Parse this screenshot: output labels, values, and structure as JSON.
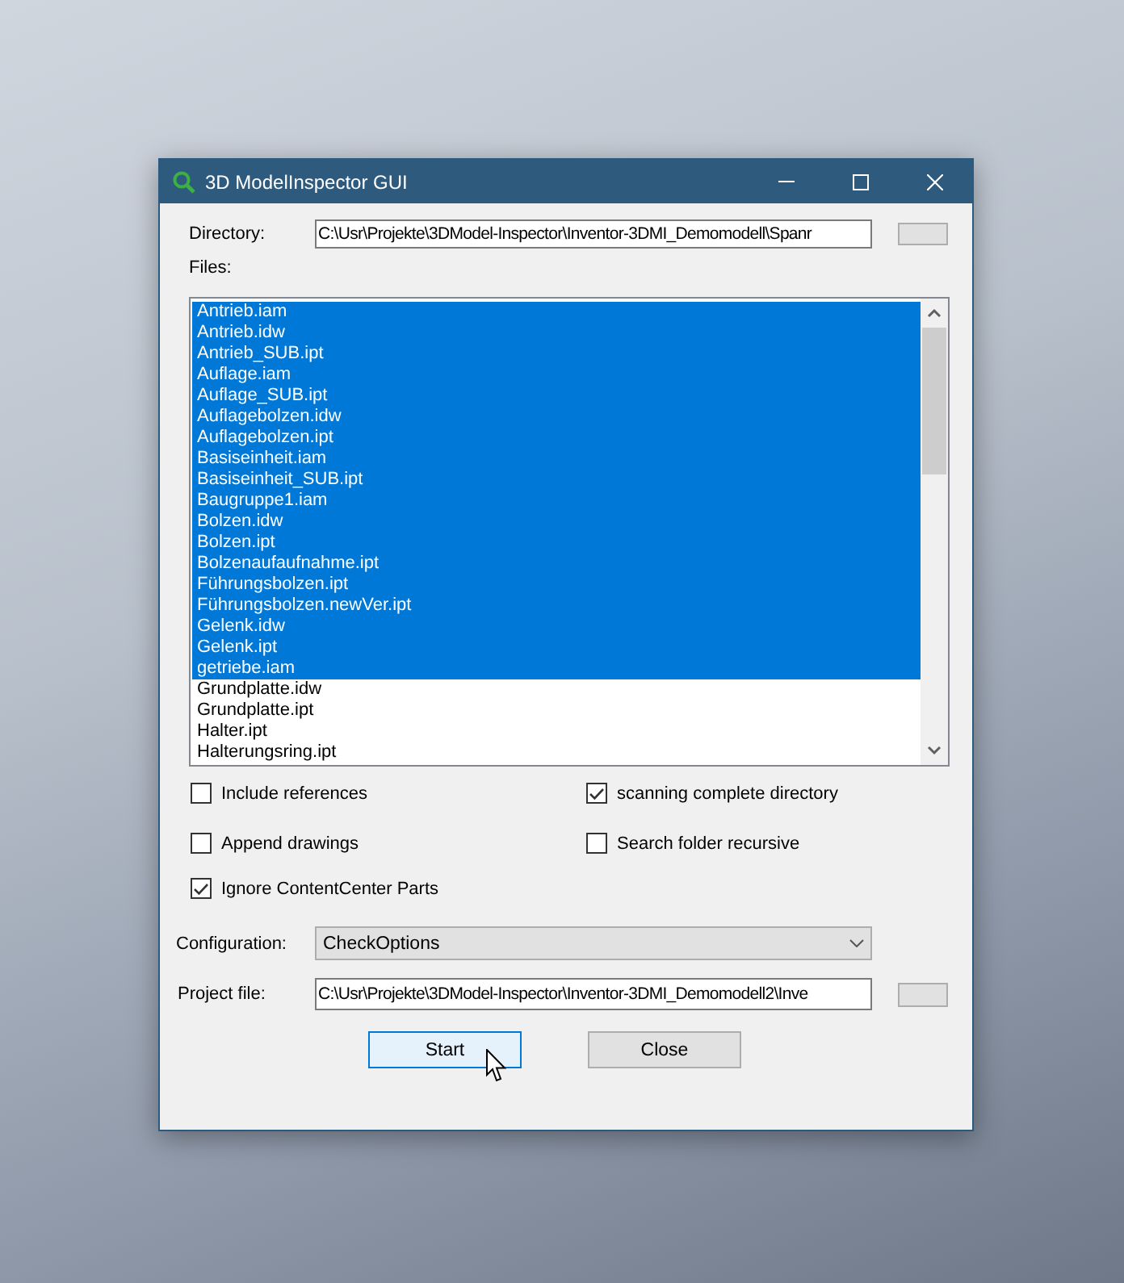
{
  "window": {
    "title": "3D ModelInspector GUI"
  },
  "directory": {
    "label": "Directory:",
    "value": "C:\\Usr\\Projekte\\3DModel-Inspector\\Inventor-3DMI_Demomodell\\Spanr"
  },
  "files": {
    "label": "Files:",
    "items": [
      {
        "name": "Antrieb.iam",
        "selected": true
      },
      {
        "name": "Antrieb.idw",
        "selected": true
      },
      {
        "name": "Antrieb_SUB.ipt",
        "selected": true
      },
      {
        "name": "Auflage.iam",
        "selected": true
      },
      {
        "name": "Auflage_SUB.ipt",
        "selected": true
      },
      {
        "name": "Auflagebolzen.idw",
        "selected": true
      },
      {
        "name": "Auflagebolzen.ipt",
        "selected": true
      },
      {
        "name": "Basiseinheit.iam",
        "selected": true
      },
      {
        "name": "Basiseinheit_SUB.ipt",
        "selected": true
      },
      {
        "name": "Baugruppe1.iam",
        "selected": true
      },
      {
        "name": "Bolzen.idw",
        "selected": true
      },
      {
        "name": "Bolzen.ipt",
        "selected": true
      },
      {
        "name": "Bolzenaufaufnahme.ipt",
        "selected": true
      },
      {
        "name": "Führungsbolzen.ipt",
        "selected": true
      },
      {
        "name": "Führungsbolzen.newVer.ipt",
        "selected": true
      },
      {
        "name": "Gelenk.idw",
        "selected": true
      },
      {
        "name": "Gelenk.ipt",
        "selected": true
      },
      {
        "name": "getriebe.iam",
        "selected": true
      },
      {
        "name": "Grundplatte.idw",
        "selected": false
      },
      {
        "name": "Grundplatte.ipt",
        "selected": false
      },
      {
        "name": "Halter.ipt",
        "selected": false
      },
      {
        "name": "Halterungsring.ipt",
        "selected": false
      }
    ]
  },
  "options": [
    {
      "label": "Include references",
      "checked": false
    },
    {
      "label": "scanning complete directory",
      "checked": true
    },
    {
      "label": "Append drawings",
      "checked": false
    },
    {
      "label": "Search folder recursive",
      "checked": false
    },
    {
      "label": "Ignore ContentCenter Parts",
      "checked": true
    }
  ],
  "configuration": {
    "label": "Configuration:",
    "value": "CheckOptions"
  },
  "project_file": {
    "label": "Project file:",
    "value": "C:\\Usr\\Projekte\\3DModel-Inspector\\Inventor-3DMI_Demomodell2\\Inve"
  },
  "buttons": [
    {
      "label": "Start",
      "focused": true
    },
    {
      "label": "Close",
      "focused": false
    }
  ]
}
